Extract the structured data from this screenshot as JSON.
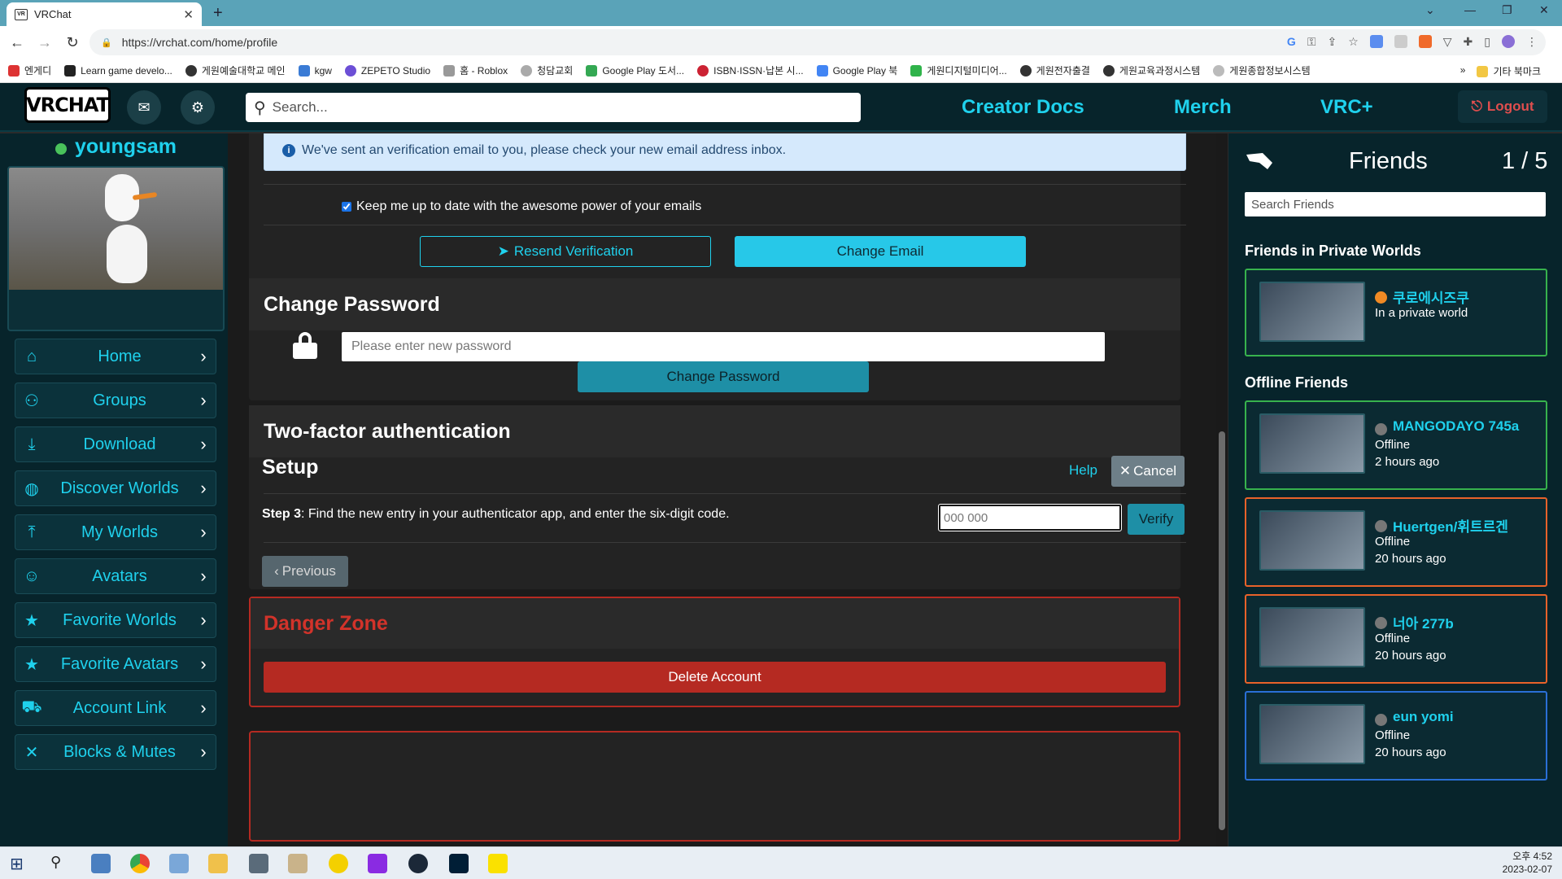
{
  "browser": {
    "tab_title": "VRChat",
    "tab_favicon": "VR",
    "url": "https://vrchat.com/home/profile",
    "bookmarks": [
      "엔게디",
      "Learn game develo...",
      "게원예술대학교 메인",
      "kgw",
      "ZEPETO Studio",
      "홈 - Roblox",
      "청담교회",
      "Google Play 도서...",
      "ISBN·ISSN·납본 시...",
      "Google Play 북",
      "게원디지털미디어...",
      "게원전자출결",
      "게원교육과정시스템",
      "게원종합정보시스템"
    ],
    "bookmark_more": "»",
    "bookmark_other": "기타 북마크"
  },
  "header": {
    "logo_text": "VRCHAT",
    "search_placeholder": "Search...",
    "links": [
      "Creator Docs",
      "Merch",
      "VRC+"
    ],
    "logout_label": "Logout"
  },
  "sidebar": {
    "username": "youngsam",
    "nav": [
      {
        "label": "Home",
        "icon": "home-icon",
        "glyph": "⌂"
      },
      {
        "label": "Groups",
        "icon": "groups-icon",
        "glyph": "⚇"
      },
      {
        "label": "Download",
        "icon": "download-icon",
        "glyph": "⤓"
      },
      {
        "label": "Discover Worlds",
        "icon": "globe-icon",
        "glyph": "◍"
      },
      {
        "label": "My Worlds",
        "icon": "upload-icon",
        "glyph": "⤒"
      },
      {
        "label": "Avatars",
        "icon": "avatar-icon",
        "glyph": "☺"
      },
      {
        "label": "Favorite Worlds",
        "icon": "star-icon",
        "glyph": "★"
      },
      {
        "label": "Favorite Avatars",
        "icon": "star-icon",
        "glyph": "★"
      },
      {
        "label": "Account Link",
        "icon": "truck-icon",
        "glyph": "⛟"
      },
      {
        "label": "Blocks & Mutes",
        "icon": "mute-icon",
        "glyph": "✕"
      }
    ]
  },
  "email": {
    "banner_text": "We've sent an verification email to you, please check your new email address inbox.",
    "checkbox_label": "Keep me up to date with the awesome power of your emails",
    "resend_label": "Resend Verification",
    "change_email_label": "Change Email"
  },
  "password": {
    "title": "Change Password",
    "placeholder": "Please enter new password",
    "button_label": "Change Password"
  },
  "twofa": {
    "title": "Two-factor authentication",
    "setup_title": "Setup",
    "help_label": "Help",
    "cancel_label": "Cancel",
    "step_label": "Step 3",
    "step_text": ": Find the new entry in your authenticator app, and enter the six-digit code.",
    "code_placeholder": "000 000",
    "verify_label": "Verify",
    "previous_label": "Previous"
  },
  "danger": {
    "title": "Danger Zone",
    "delete_label": "Delete Account"
  },
  "friends": {
    "title": "Friends",
    "count": "1 / 5",
    "search_placeholder": "Search Friends",
    "private_section": "Friends in Private Worlds",
    "offline_section": "Offline Friends",
    "private": [
      {
        "name": "쿠로에시즈쿠",
        "status": "In a private world",
        "dot": "#f08a24",
        "border": "#37b24d"
      }
    ],
    "offline": [
      {
        "name": "MANGODAYO 745a",
        "status": "Offline",
        "time": "2 hours ago",
        "border": "#37b24d"
      },
      {
        "name": "Huertgen/휘트르겐",
        "status": "Offline",
        "time": "20 hours ago",
        "border": "#e8622a"
      },
      {
        "name": "너아 277b",
        "status": "Offline",
        "time": "20 hours ago",
        "border": "#e8622a"
      },
      {
        "name": "eun yomi",
        "status": "Offline",
        "time": "20 hours ago",
        "border": "#2a6fd6"
      }
    ]
  },
  "taskbar": {
    "time": "오후 4:52",
    "date": "2023-02-07"
  }
}
